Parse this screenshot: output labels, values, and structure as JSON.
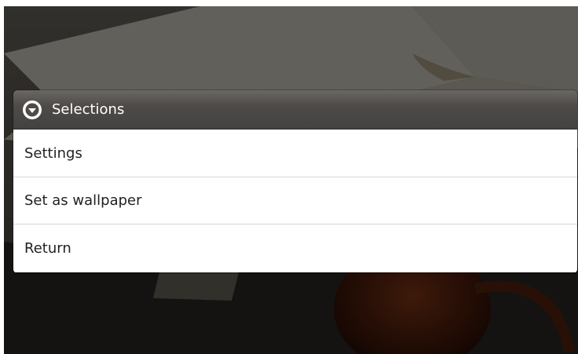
{
  "dialog": {
    "title": "Selections",
    "icon": "dropdown-circle-icon",
    "items": [
      {
        "label": "Settings"
      },
      {
        "label": "Set as wallpaper"
      },
      {
        "label": "Return"
      }
    ]
  },
  "colors": {
    "header_bg": "#4e4b49",
    "list_bg": "#ffffff",
    "item_text": "#222222",
    "title_text": "#ffffff"
  }
}
